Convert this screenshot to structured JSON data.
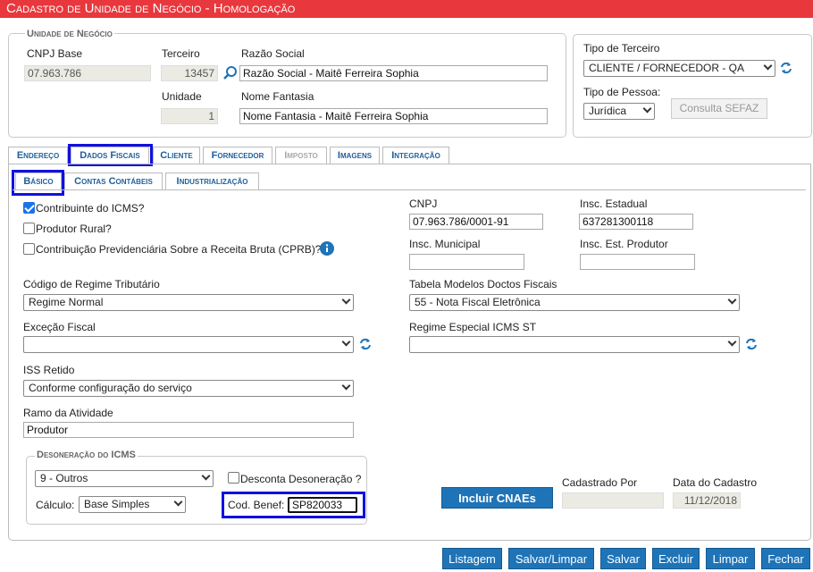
{
  "title": "Cadastro de Unidade de Negócio - Homologação",
  "unidade": {
    "legend": "Unidade de Negócio",
    "cnpj_base_label": "CNPJ Base",
    "cnpj_base_value": "07.963.786",
    "terceiro_label": "Terceiro",
    "terceiro_value": "13457",
    "razao_label": "Razão Social",
    "razao_value": "Razão Social - Maitê Ferreira Sophia",
    "unidade_label": "Unidade",
    "unidade_value": "1",
    "fantasia_label": "Nome Fantasia",
    "fantasia_value": "Nome Fantasia - Maitê Ferreira Sophia"
  },
  "tipo": {
    "tipo_terceiro_label": "Tipo de Terceiro",
    "tipo_terceiro_value": "CLIENTE / FORNECEDOR - QA",
    "tipo_pessoa_label": "Tipo de Pessoa:",
    "tipo_pessoa_value": "Jurídica",
    "sefaz_button": "Consulta SEFAZ"
  },
  "tabs": [
    "Endereço",
    "Dados Fiscais",
    "Cliente",
    "Fornecedor",
    "Imposto",
    "Imagens",
    "Integração"
  ],
  "subtabs": [
    "Básico",
    "Contas Contábeis",
    "Industrialização"
  ],
  "fiscal": {
    "contribuinte_icms": "Contribuinte do ICMS?",
    "produtor_rural": "Produtor Rural?",
    "cprb": "Contribuição Previdenciária Sobre a Receita Bruta (CPRB)?",
    "cnpj_label": "CNPJ",
    "cnpj_value": "07.963.786/0001-91",
    "ie_label": "Insc. Estadual",
    "ie_value": "637281300118",
    "im_label": "Insc. Municipal",
    "im_value": "",
    "iep_label": "Insc. Est. Produtor",
    "iep_value": "",
    "crt_label": "Código de Regime Tributário",
    "crt_value": "Regime Normal",
    "tabela_label": "Tabela Modelos Doctos Fiscais",
    "tabela_value": "55 - Nota Fiscal Eletrônica",
    "excecao_label": "Exceção Fiscal",
    "excecao_value": "",
    "regime_st_label": "Regime Especial ICMS ST",
    "regime_st_value": "",
    "iss_label": "ISS Retido",
    "iss_value": "Conforme configuração do serviço",
    "ramo_label": "Ramo da Atividade",
    "ramo_value": "Produtor"
  },
  "desoneracao": {
    "legend": "Desoneração do ICMS",
    "motivo_value": "9 - Outros",
    "desconta_label": "Desconta Desoneração ?",
    "calculo_label": "Cálculo:",
    "calculo_value": "Base Simples",
    "cod_benef_label": "Cod. Benef:",
    "cod_benef_value": "SP820033"
  },
  "cnae_button": "Incluir CNAEs",
  "cadastrado_por_label": "Cadastrado Por",
  "cadastrado_por_value": "",
  "data_cadastro_label": "Data do Cadastro",
  "data_cadastro_value": "11/12/2018",
  "footer_buttons": [
    "Listagem",
    "Salvar/Limpar",
    "Salvar",
    "Excluir",
    "Limpar",
    "Fechar"
  ],
  "colors": {
    "title_bar": "#e8383d",
    "button": "#1f74b8",
    "tab_text": "#1f5f9a",
    "highlight": "#1010e0"
  }
}
